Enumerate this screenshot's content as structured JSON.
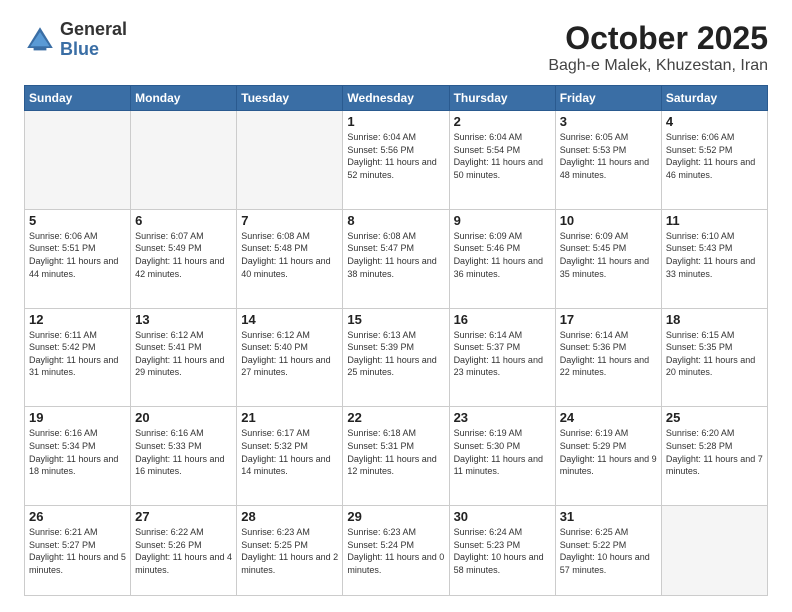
{
  "header": {
    "logo_general": "General",
    "logo_blue": "Blue",
    "title": "October 2025",
    "subtitle": "Bagh-e Malek, Khuzestan, Iran"
  },
  "days_of_week": [
    "Sunday",
    "Monday",
    "Tuesday",
    "Wednesday",
    "Thursday",
    "Friday",
    "Saturday"
  ],
  "weeks": [
    [
      {
        "num": "",
        "info": ""
      },
      {
        "num": "",
        "info": ""
      },
      {
        "num": "",
        "info": ""
      },
      {
        "num": "1",
        "info": "Sunrise: 6:04 AM\nSunset: 5:56 PM\nDaylight: 11 hours and 52 minutes."
      },
      {
        "num": "2",
        "info": "Sunrise: 6:04 AM\nSunset: 5:54 PM\nDaylight: 11 hours and 50 minutes."
      },
      {
        "num": "3",
        "info": "Sunrise: 6:05 AM\nSunset: 5:53 PM\nDaylight: 11 hours and 48 minutes."
      },
      {
        "num": "4",
        "info": "Sunrise: 6:06 AM\nSunset: 5:52 PM\nDaylight: 11 hours and 46 minutes."
      }
    ],
    [
      {
        "num": "5",
        "info": "Sunrise: 6:06 AM\nSunset: 5:51 PM\nDaylight: 11 hours and 44 minutes."
      },
      {
        "num": "6",
        "info": "Sunrise: 6:07 AM\nSunset: 5:49 PM\nDaylight: 11 hours and 42 minutes."
      },
      {
        "num": "7",
        "info": "Sunrise: 6:08 AM\nSunset: 5:48 PM\nDaylight: 11 hours and 40 minutes."
      },
      {
        "num": "8",
        "info": "Sunrise: 6:08 AM\nSunset: 5:47 PM\nDaylight: 11 hours and 38 minutes."
      },
      {
        "num": "9",
        "info": "Sunrise: 6:09 AM\nSunset: 5:46 PM\nDaylight: 11 hours and 36 minutes."
      },
      {
        "num": "10",
        "info": "Sunrise: 6:09 AM\nSunset: 5:45 PM\nDaylight: 11 hours and 35 minutes."
      },
      {
        "num": "11",
        "info": "Sunrise: 6:10 AM\nSunset: 5:43 PM\nDaylight: 11 hours and 33 minutes."
      }
    ],
    [
      {
        "num": "12",
        "info": "Sunrise: 6:11 AM\nSunset: 5:42 PM\nDaylight: 11 hours and 31 minutes."
      },
      {
        "num": "13",
        "info": "Sunrise: 6:12 AM\nSunset: 5:41 PM\nDaylight: 11 hours and 29 minutes."
      },
      {
        "num": "14",
        "info": "Sunrise: 6:12 AM\nSunset: 5:40 PM\nDaylight: 11 hours and 27 minutes."
      },
      {
        "num": "15",
        "info": "Sunrise: 6:13 AM\nSunset: 5:39 PM\nDaylight: 11 hours and 25 minutes."
      },
      {
        "num": "16",
        "info": "Sunrise: 6:14 AM\nSunset: 5:37 PM\nDaylight: 11 hours and 23 minutes."
      },
      {
        "num": "17",
        "info": "Sunrise: 6:14 AM\nSunset: 5:36 PM\nDaylight: 11 hours and 22 minutes."
      },
      {
        "num": "18",
        "info": "Sunrise: 6:15 AM\nSunset: 5:35 PM\nDaylight: 11 hours and 20 minutes."
      }
    ],
    [
      {
        "num": "19",
        "info": "Sunrise: 6:16 AM\nSunset: 5:34 PM\nDaylight: 11 hours and 18 minutes."
      },
      {
        "num": "20",
        "info": "Sunrise: 6:16 AM\nSunset: 5:33 PM\nDaylight: 11 hours and 16 minutes."
      },
      {
        "num": "21",
        "info": "Sunrise: 6:17 AM\nSunset: 5:32 PM\nDaylight: 11 hours and 14 minutes."
      },
      {
        "num": "22",
        "info": "Sunrise: 6:18 AM\nSunset: 5:31 PM\nDaylight: 11 hours and 12 minutes."
      },
      {
        "num": "23",
        "info": "Sunrise: 6:19 AM\nSunset: 5:30 PM\nDaylight: 11 hours and 11 minutes."
      },
      {
        "num": "24",
        "info": "Sunrise: 6:19 AM\nSunset: 5:29 PM\nDaylight: 11 hours and 9 minutes."
      },
      {
        "num": "25",
        "info": "Sunrise: 6:20 AM\nSunset: 5:28 PM\nDaylight: 11 hours and 7 minutes."
      }
    ],
    [
      {
        "num": "26",
        "info": "Sunrise: 6:21 AM\nSunset: 5:27 PM\nDaylight: 11 hours and 5 minutes."
      },
      {
        "num": "27",
        "info": "Sunrise: 6:22 AM\nSunset: 5:26 PM\nDaylight: 11 hours and 4 minutes."
      },
      {
        "num": "28",
        "info": "Sunrise: 6:23 AM\nSunset: 5:25 PM\nDaylight: 11 hours and 2 minutes."
      },
      {
        "num": "29",
        "info": "Sunrise: 6:23 AM\nSunset: 5:24 PM\nDaylight: 11 hours and 0 minutes."
      },
      {
        "num": "30",
        "info": "Sunrise: 6:24 AM\nSunset: 5:23 PM\nDaylight: 10 hours and 58 minutes."
      },
      {
        "num": "31",
        "info": "Sunrise: 6:25 AM\nSunset: 5:22 PM\nDaylight: 10 hours and 57 minutes."
      },
      {
        "num": "",
        "info": ""
      }
    ]
  ]
}
